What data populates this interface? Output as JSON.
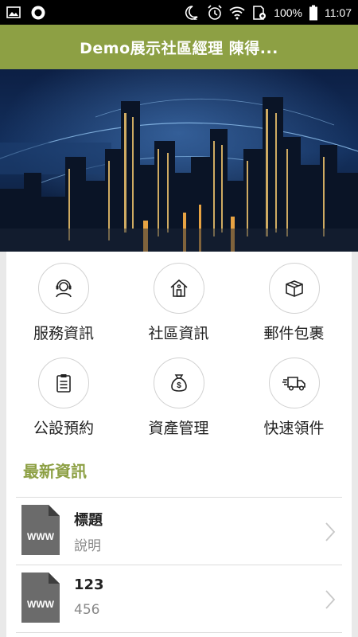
{
  "status_bar": {
    "battery": "100%",
    "time": "11:07",
    "icons": [
      "gallery-icon",
      "record-icon",
      "do-not-disturb-icon",
      "alarm-icon",
      "wifi-icon",
      "sd-card-icon",
      "battery-icon"
    ]
  },
  "header": {
    "title": "Demo展示社區經理 陳得..."
  },
  "banner": {
    "description_icon": "city-night-banner"
  },
  "menu": {
    "items": [
      {
        "label": "服務資訊",
        "icon": "headset-user-icon"
      },
      {
        "label": "社區資訊",
        "icon": "house-icon"
      },
      {
        "label": "郵件包裹",
        "icon": "package-box-icon"
      },
      {
        "label": "公設預約",
        "icon": "clipboard-icon"
      },
      {
        "label": "資產管理",
        "icon": "money-bag-icon"
      },
      {
        "label": "快速領件",
        "icon": "delivery-truck-icon"
      }
    ]
  },
  "news": {
    "section_title": "最新資訊",
    "items": [
      {
        "title": "標題",
        "desc": "說明",
        "icon_text": "WWW"
      },
      {
        "title": "123",
        "desc": "456",
        "icon_text": "WWW"
      }
    ]
  },
  "colors": {
    "accent": "#8da044",
    "status_bar": "#000000",
    "panel_bg": "#ffffff",
    "page_bg": "#e9e9e9"
  }
}
